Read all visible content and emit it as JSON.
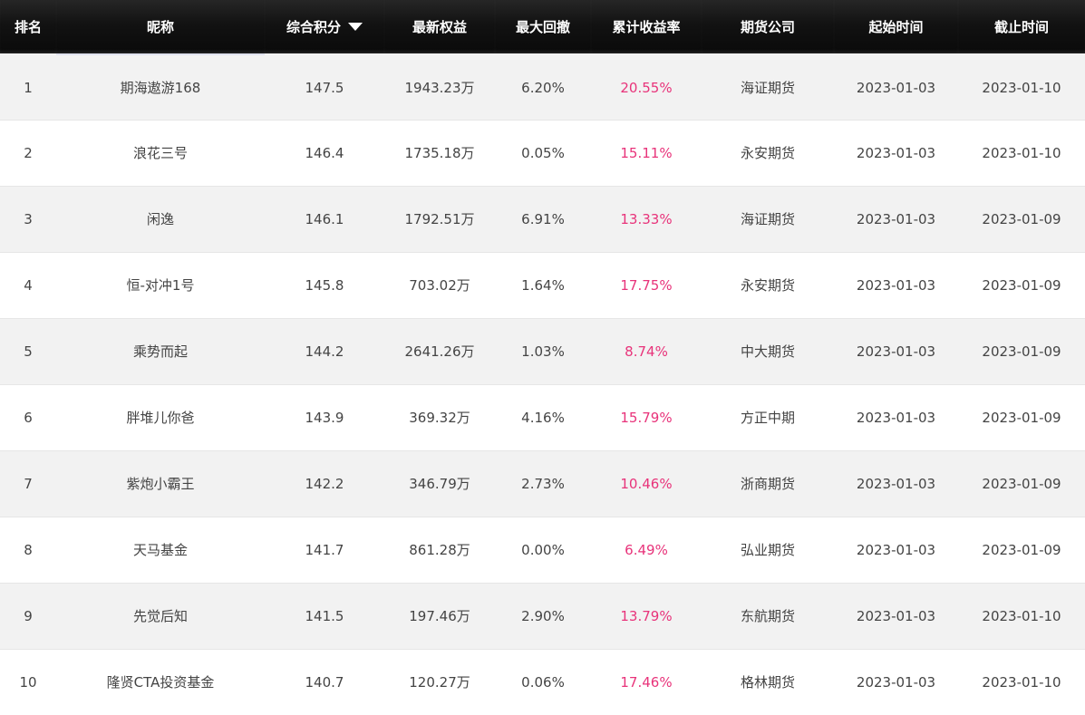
{
  "table": {
    "headers": {
      "rank": "排名",
      "nickname": "昵称",
      "score": "综合积分",
      "equity": "最新权益",
      "drawdown": "最大回撤",
      "return_rate": "累计收益率",
      "company": "期货公司",
      "start": "起始时间",
      "end": "截止时间"
    },
    "sort_indicator": "caret-down-icon",
    "rows": [
      {
        "rank": "1",
        "nickname": "期海遨游168",
        "score": "147.5",
        "equity": "1943.23万",
        "drawdown": "6.20%",
        "return_rate": "20.55%",
        "company": "海证期货",
        "start": "2023-01-03",
        "end": "2023-01-10"
      },
      {
        "rank": "2",
        "nickname": "浪花三号",
        "score": "146.4",
        "equity": "1735.18万",
        "drawdown": "0.05%",
        "return_rate": "15.11%",
        "company": "永安期货",
        "start": "2023-01-03",
        "end": "2023-01-10"
      },
      {
        "rank": "3",
        "nickname": "闲逸",
        "score": "146.1",
        "equity": "1792.51万",
        "drawdown": "6.91%",
        "return_rate": "13.33%",
        "company": "海证期货",
        "start": "2023-01-03",
        "end": "2023-01-09"
      },
      {
        "rank": "4",
        "nickname": "恒-对冲1号",
        "score": "145.8",
        "equity": "703.02万",
        "drawdown": "1.64%",
        "return_rate": "17.75%",
        "company": "永安期货",
        "start": "2023-01-03",
        "end": "2023-01-09"
      },
      {
        "rank": "5",
        "nickname": "乘势而起",
        "score": "144.2",
        "equity": "2641.26万",
        "drawdown": "1.03%",
        "return_rate": "8.74%",
        "company": "中大期货",
        "start": "2023-01-03",
        "end": "2023-01-09"
      },
      {
        "rank": "6",
        "nickname": "胖堆儿你爸",
        "score": "143.9",
        "equity": "369.32万",
        "drawdown": "4.16%",
        "return_rate": "15.79%",
        "company": "方正中期",
        "start": "2023-01-03",
        "end": "2023-01-09"
      },
      {
        "rank": "7",
        "nickname": "紫炮小霸王",
        "score": "142.2",
        "equity": "346.79万",
        "drawdown": "2.73%",
        "return_rate": "10.46%",
        "company": "浙商期货",
        "start": "2023-01-03",
        "end": "2023-01-09"
      },
      {
        "rank": "8",
        "nickname": "天马基金",
        "score": "141.7",
        "equity": "861.28万",
        "drawdown": "0.00%",
        "return_rate": "6.49%",
        "company": "弘业期货",
        "start": "2023-01-03",
        "end": "2023-01-09"
      },
      {
        "rank": "9",
        "nickname": "先觉后知",
        "score": "141.5",
        "equity": "197.46万",
        "drawdown": "2.90%",
        "return_rate": "13.79%",
        "company": "东航期货",
        "start": "2023-01-03",
        "end": "2023-01-10"
      },
      {
        "rank": "10",
        "nickname": "隆贤CTA投资基金",
        "score": "140.7",
        "equity": "120.27万",
        "drawdown": "0.06%",
        "return_rate": "17.46%",
        "company": "格林期货",
        "start": "2023-01-03",
        "end": "2023-01-10"
      }
    ]
  },
  "colors": {
    "header_bg": "#0f0f0f",
    "return_rate": "#e8337a",
    "row_alt": "#f2f2f2",
    "text": "#444444"
  }
}
